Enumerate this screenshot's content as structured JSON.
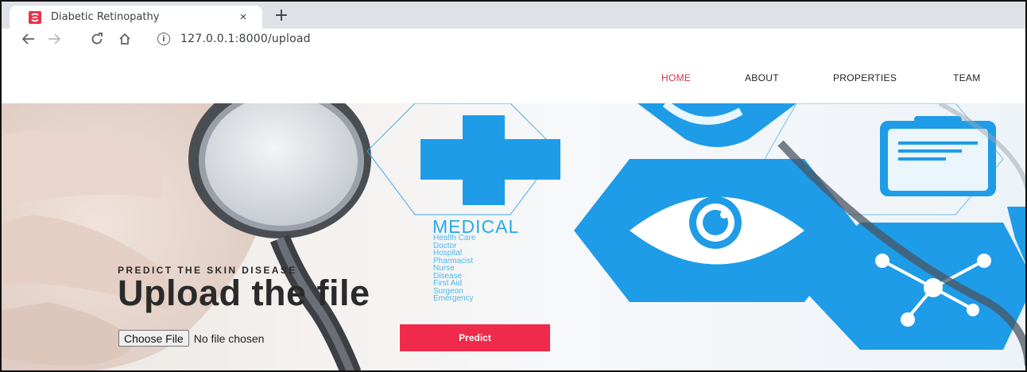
{
  "browser": {
    "tab_title": "Diabetic Retinopathy",
    "close_glyph": "×",
    "new_tab_glyph": "+",
    "url": "127.0.0.1:8000/upload",
    "favicon_color": "#e8334a",
    "icons": [
      "back-icon",
      "forward-icon",
      "reload-icon",
      "home-icon",
      "info-icon"
    ]
  },
  "nav": {
    "items": [
      {
        "label": "HOME",
        "active": true
      },
      {
        "label": "ABOUT",
        "active": false
      },
      {
        "label": "PROPERTIES",
        "active": false
      },
      {
        "label": "TEAM",
        "active": false
      }
    ],
    "active_color": "#d8324a"
  },
  "hero": {
    "subtitle": "PREDICT THE SKIN DISEASE",
    "headline": "Upload the file",
    "medical": {
      "title": "MEDICAL",
      "items": [
        "Health Care",
        "Doctor",
        "Hospital",
        "Pharmacist",
        "Nurse",
        "Disease",
        "First Aid",
        "Surgeon",
        "Emergency"
      ]
    },
    "accent_blue": "#1e9ce8"
  },
  "upload": {
    "choose_label": "Choose File",
    "no_file_text": "No file chosen",
    "predict_label": "Predict",
    "predict_color": "#ef2a4a"
  }
}
